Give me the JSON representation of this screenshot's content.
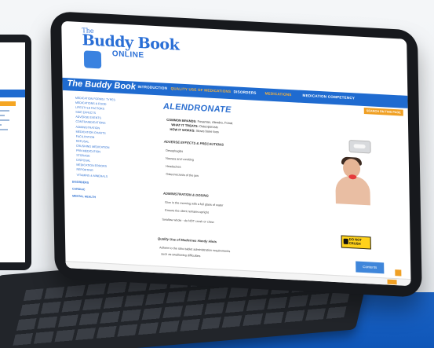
{
  "app": {
    "logo_top": "The",
    "logo_main": "Buddy Book",
    "logo_sub": "ONLINE",
    "brand": "The Buddy Book"
  },
  "nav": {
    "items": [
      "INTRODUCTION",
      "QUALITY USE OF MEDICATIONS",
      "DISORDERS",
      "MEDICATIONS",
      "MEDICATION COMPETENCY"
    ],
    "active_index": 1
  },
  "search_label": "SEARCH ON THIS PAGE",
  "sidebar": {
    "items": [
      "MEDICATION FORMS / TYPES",
      "MEDICATIONS & FOOD",
      "LIFESTYLE FACTORS",
      "SIDE EFFECTS",
      "ADVERSE EVENTS",
      "CONTRAINDICATIONS",
      "ADMINISTRATION",
      "MEDICATION CHARTS",
      "FACILITATION",
      "REFUSAL",
      "CRUSHING MEDICATION",
      "PRN MEDICATION",
      "STORAGE",
      "DISPOSAL",
      "MEDICATION ERRORS",
      "REPORTING",
      "VITAMINS & MINERALS"
    ],
    "headings": [
      "DISORDERS",
      "CARDIAC",
      "MENTAL HEALTH"
    ]
  },
  "content": {
    "title": "ALENDRONATE",
    "common_brands_label": "COMMON BRANDS:",
    "common_brands": "Fosamax, Alendro, Fonat",
    "treats_label": "WHAT IT TREATS:",
    "treats": "Osteoporosis",
    "how_label": "HOW IT WORKS:",
    "how": "Slows bone loss",
    "sec_effects": "ADVERSE EFFECTS & PRECAUTIONS",
    "effects": [
      "Oesophagitis",
      "Nausea and vomiting",
      "Headaches",
      "Osteonecrosis of the jaw"
    ],
    "sec_admin": "ADMINISTRATION & DOSING",
    "admin": [
      "Give in the morning with a full glass of water",
      "Ensure the client remains upright",
      "Swallow whole - do NOT crush or chew"
    ],
    "sec_quality": "Quality Use of Medicines Handy Hints",
    "quality": [
      "Adhere to the strict tablet administration requirements",
      "such as swallowing difficulties"
    ],
    "do_not_crush": "DO NOT\nCRUSH",
    "contents_label": "Contents"
  },
  "colors": {
    "primary": "#1f6bd0",
    "accent": "#f0a024",
    "floor": "#1b63c5"
  }
}
